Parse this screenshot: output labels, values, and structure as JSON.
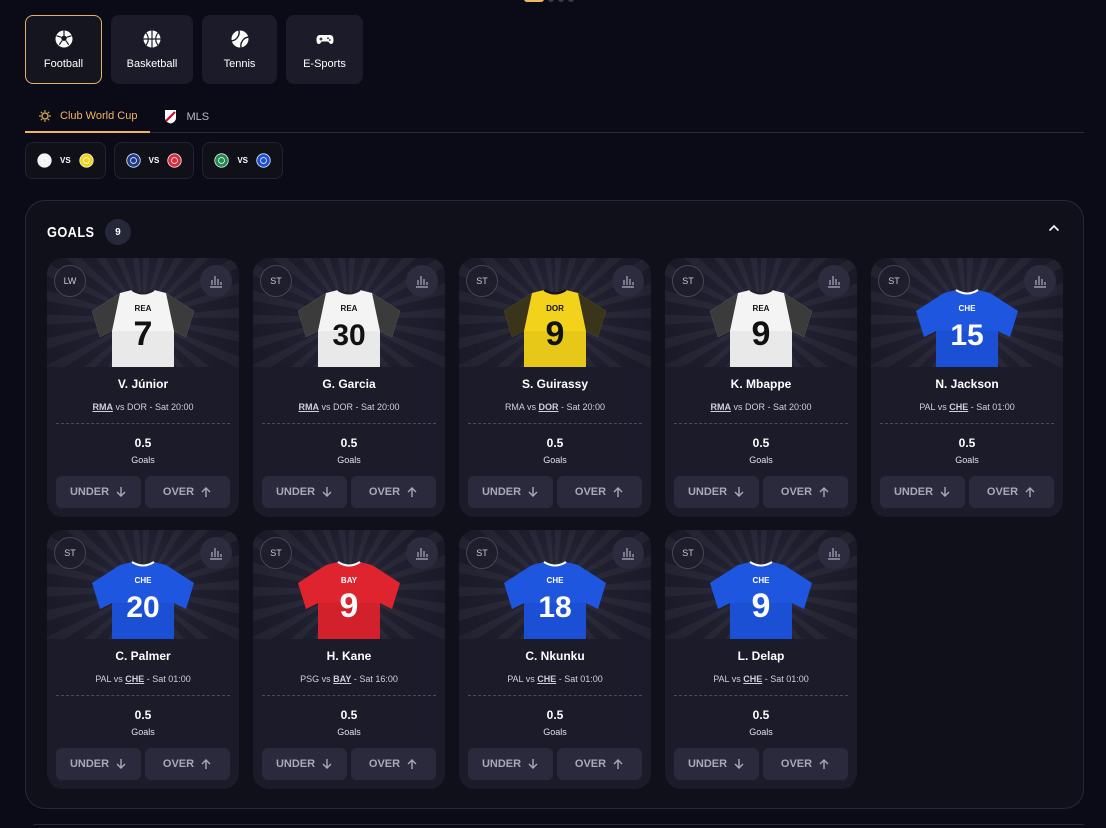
{
  "sports": [
    {
      "label": "Football",
      "icon": "soccer-ball-icon",
      "active": true
    },
    {
      "label": "Basketball",
      "icon": "basketball-icon",
      "active": false
    },
    {
      "label": "Tennis",
      "icon": "tennis-ball-icon",
      "active": false
    },
    {
      "label": "E-Sports",
      "icon": "gamepad-icon",
      "active": false
    }
  ],
  "competitions": [
    {
      "label": "Club World Cup",
      "icon": "club-world-cup-icon",
      "active": true
    },
    {
      "label": "MLS",
      "icon": "mls-icon",
      "active": false
    }
  ],
  "matches": [
    {
      "home": "real-madrid-crest",
      "away": "dortmund-crest",
      "vs": "VS",
      "home_color": "#f3f3f3",
      "away_color": "#f2d21b"
    },
    {
      "home": "psg-crest",
      "away": "bayern-crest",
      "vs": "VS",
      "home_color": "#1f3a8a",
      "away_color": "#dc2b3a"
    },
    {
      "home": "palmeiras-crest",
      "away": "chelsea-crest",
      "vs": "VS",
      "home_color": "#1f8a4c",
      "away_color": "#1d4ed8"
    }
  ],
  "panel": {
    "title": "GOALS",
    "count": "9"
  },
  "colors": {
    "accent": "#f0b465",
    "background": "#0b0b17",
    "card": "#1b1b2a"
  },
  "cards": [
    {
      "position": "LW",
      "name": "V. Júnior",
      "team_code": "REA",
      "number": "7",
      "jersey": "white",
      "home": "RMA",
      "away": "DOR",
      "highlight": "home",
      "time": "Sat 20:00",
      "line": "0.5",
      "stat": "Goals",
      "under": "UNDER",
      "over": "OVER"
    },
    {
      "position": "ST",
      "name": "G. Garcia",
      "team_code": "REA",
      "number": "30",
      "jersey": "white",
      "home": "RMA",
      "away": "DOR",
      "highlight": "home",
      "time": "Sat 20:00",
      "line": "0.5",
      "stat": "Goals",
      "under": "UNDER",
      "over": "OVER"
    },
    {
      "position": "ST",
      "name": "S. Guirassy",
      "team_code": "DOR",
      "number": "9",
      "jersey": "yellow",
      "home": "RMA",
      "away": "DOR",
      "highlight": "away",
      "time": "Sat 20:00",
      "line": "0.5",
      "stat": "Goals",
      "under": "UNDER",
      "over": "OVER"
    },
    {
      "position": "ST",
      "name": "K. Mbappe",
      "team_code": "REA",
      "number": "9",
      "jersey": "white",
      "home": "RMA",
      "away": "DOR",
      "highlight": "home",
      "time": "Sat 20:00",
      "line": "0.5",
      "stat": "Goals",
      "under": "UNDER",
      "over": "OVER"
    },
    {
      "position": "ST",
      "name": "N. Jackson",
      "team_code": "CHE",
      "number": "15",
      "jersey": "blue",
      "home": "PAL",
      "away": "CHE",
      "highlight": "away",
      "time": "Sat 01:00",
      "line": "0.5",
      "stat": "Goals",
      "under": "UNDER",
      "over": "OVER"
    },
    {
      "position": "ST",
      "name": "C. Palmer",
      "team_code": "CHE",
      "number": "20",
      "jersey": "blue",
      "home": "PAL",
      "away": "CHE",
      "highlight": "away",
      "time": "Sat 01:00",
      "line": "0.5",
      "stat": "Goals",
      "under": "UNDER",
      "over": "OVER"
    },
    {
      "position": "ST",
      "name": "H. Kane",
      "team_code": "BAY",
      "number": "9",
      "jersey": "red",
      "home": "PSG",
      "away": "BAY",
      "highlight": "away",
      "time": "Sat 16:00",
      "line": "0.5",
      "stat": "Goals",
      "under": "UNDER",
      "over": "OVER"
    },
    {
      "position": "ST",
      "name": "C. Nkunku",
      "team_code": "CHE",
      "number": "18",
      "jersey": "blue",
      "home": "PAL",
      "away": "CHE",
      "highlight": "away",
      "time": "Sat 01:00",
      "line": "0.5",
      "stat": "Goals",
      "under": "UNDER",
      "over": "OVER"
    },
    {
      "position": "ST",
      "name": "L. Delap",
      "team_code": "CHE",
      "number": "9",
      "jersey": "blue",
      "home": "PAL",
      "away": "CHE",
      "highlight": "away",
      "time": "Sat 01:00",
      "line": "0.5",
      "stat": "Goals",
      "under": "UNDER",
      "over": "OVER"
    }
  ],
  "fixture_sep": "vs",
  "time_sep": "-"
}
